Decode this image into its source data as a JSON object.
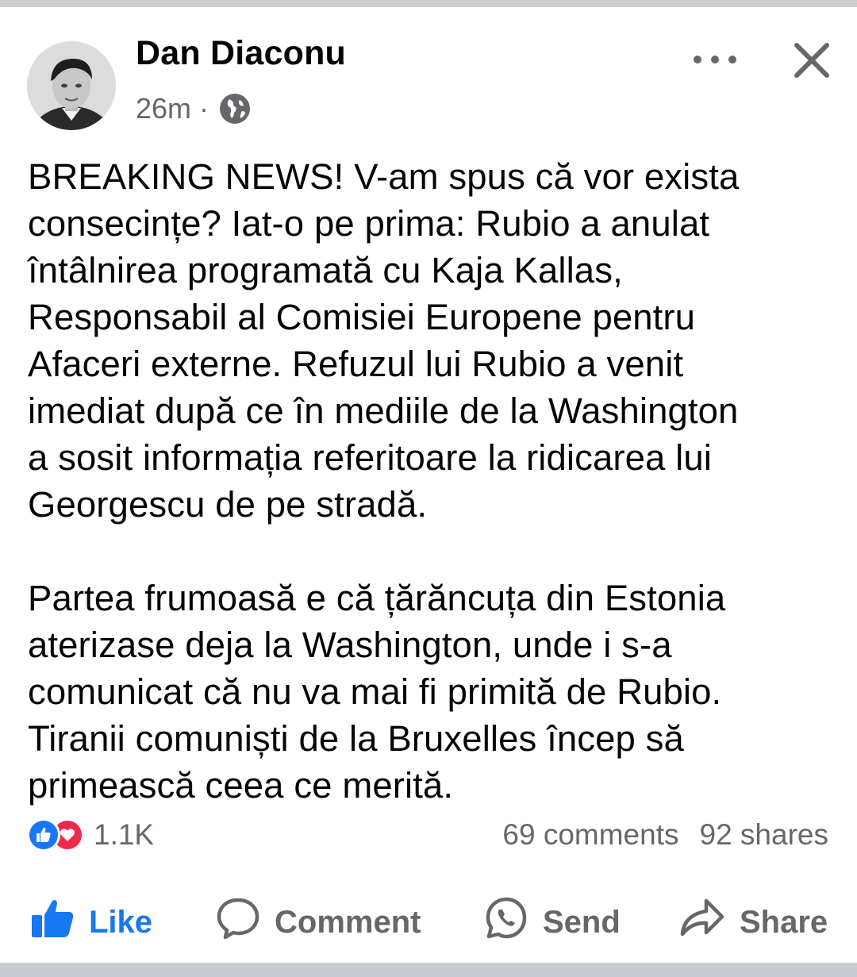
{
  "post": {
    "author": "Dan Diaconu",
    "time": "26m",
    "separator": "·",
    "audience_icon": "globe-icon",
    "paragraphs": [
      "BREAKING NEWS! V-am spus că vor exista\nconsecințe? Iat-o pe prima: Rubio a anulat\nîntâlnirea programată cu Kaja Kallas,\nResponsabil al Comisiei Europene pentru\nAfaceri externe. Refuzul lui Rubio a venit\nimediat după ce în mediile de la Washington\na sosit informația referitoare la ridicarea lui\nGeorgescu de pe stradă.",
      "Partea frumoasă e că țărăncuța din Estonia\naterizase deja la Washington, unde i s-a\ncomunicat că nu va mai fi primită de Rubio.\nTiranii comuniști de la Bruxelles încep să\nprimească ceea ce merită."
    ]
  },
  "engagement": {
    "reaction_icons": [
      "like-reaction-icon",
      "love-reaction-icon"
    ],
    "reaction_count": "1.1K",
    "comments": "69 comments",
    "shares": "92 shares"
  },
  "actions": {
    "like": "Like",
    "comment": "Comment",
    "send": "Send",
    "share": "Share"
  },
  "colors": {
    "accent": "#1877f2",
    "love": "#f0284a",
    "text": "#050505",
    "secondary": "#65676b",
    "frame": "#c9ccd1"
  }
}
